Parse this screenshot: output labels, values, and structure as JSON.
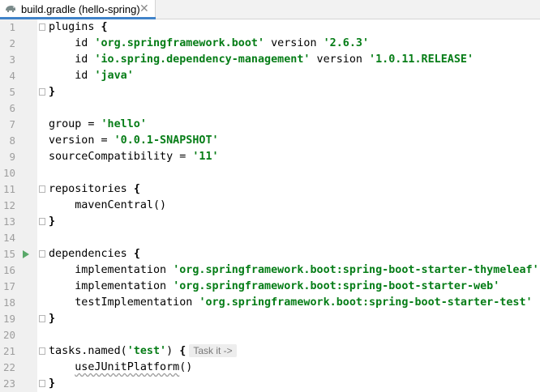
{
  "tab": {
    "title": "build.gradle (hello-spring)",
    "close": "✕",
    "icon": "gradle-elephant-icon"
  },
  "code": {
    "lines": [
      {
        "n": "1",
        "segs": [
          {
            "t": "plugins "
          },
          {
            "t": "{",
            "c": "bold"
          }
        ]
      },
      {
        "n": "2",
        "segs": [
          {
            "t": "    id "
          },
          {
            "t": "'org.springframework.boot'",
            "c": "kw-str"
          },
          {
            "t": " version "
          },
          {
            "t": "'2.6.3'",
            "c": "kw-str"
          }
        ]
      },
      {
        "n": "3",
        "segs": [
          {
            "t": "    id "
          },
          {
            "t": "'io.spring.dependency-management'",
            "c": "kw-str"
          },
          {
            "t": " version "
          },
          {
            "t": "'1.0.11.RELEASE'",
            "c": "kw-str"
          }
        ]
      },
      {
        "n": "4",
        "segs": [
          {
            "t": "    id "
          },
          {
            "t": "'java'",
            "c": "kw-str"
          }
        ]
      },
      {
        "n": "5",
        "segs": [
          {
            "t": "}",
            "c": "bold"
          }
        ]
      },
      {
        "n": "6",
        "segs": []
      },
      {
        "n": "7",
        "segs": [
          {
            "t": "group = "
          },
          {
            "t": "'hello'",
            "c": "kw-str"
          }
        ]
      },
      {
        "n": "8",
        "segs": [
          {
            "t": "version = "
          },
          {
            "t": "'0.0.1-SNAPSHOT'",
            "c": "kw-str"
          }
        ]
      },
      {
        "n": "9",
        "segs": [
          {
            "t": "sourceCompatibility = "
          },
          {
            "t": "'11'",
            "c": "kw-str"
          }
        ]
      },
      {
        "n": "10",
        "segs": []
      },
      {
        "n": "11",
        "segs": [
          {
            "t": "repositories "
          },
          {
            "t": "{",
            "c": "bold"
          }
        ]
      },
      {
        "n": "12",
        "segs": [
          {
            "t": "    mavenCentral()"
          }
        ]
      },
      {
        "n": "13",
        "segs": [
          {
            "t": "}",
            "c": "bold"
          }
        ]
      },
      {
        "n": "14",
        "segs": []
      },
      {
        "n": "15",
        "segs": [
          {
            "t": "dependencies "
          },
          {
            "t": "{",
            "c": "bold"
          }
        ]
      },
      {
        "n": "16",
        "segs": [
          {
            "t": "    implementation "
          },
          {
            "t": "'org.springframework.boot:spring-boot-starter-thymeleaf'",
            "c": "kw-str"
          }
        ]
      },
      {
        "n": "17",
        "segs": [
          {
            "t": "    implementation "
          },
          {
            "t": "'org.springframework.boot:spring-boot-starter-web'",
            "c": "kw-str"
          }
        ]
      },
      {
        "n": "18",
        "segs": [
          {
            "t": "    testImplementation "
          },
          {
            "t": "'org.springframework.boot:spring-boot-starter-test'",
            "c": "kw-str"
          }
        ]
      },
      {
        "n": "19",
        "segs": [
          {
            "t": "}",
            "c": "bold"
          }
        ]
      },
      {
        "n": "20",
        "segs": []
      },
      {
        "n": "21",
        "segs": [
          {
            "t": "tasks.named("
          },
          {
            "t": "'test'",
            "c": "kw-str"
          },
          {
            "t": ") "
          },
          {
            "t": "{",
            "c": "bold"
          }
        ],
        "hint": "Task it ->"
      },
      {
        "n": "22",
        "segs": [
          {
            "t": "    "
          },
          {
            "t": "useJUnitPlatform",
            "c": "squiggle"
          },
          {
            "t": "()"
          }
        ]
      },
      {
        "n": "23",
        "segs": [
          {
            "t": "}",
            "c": "bold"
          }
        ]
      }
    ],
    "fold_lines": [
      "1",
      "5",
      "11",
      "13",
      "15",
      "19",
      "21",
      "23"
    ],
    "run_line": "15"
  },
  "colors": {
    "string": "#067d17",
    "line_number": "#9e9e9e",
    "gutter": "#f0f0f0",
    "tab_accent": "#4083c9",
    "run_icon": "#59a869"
  }
}
